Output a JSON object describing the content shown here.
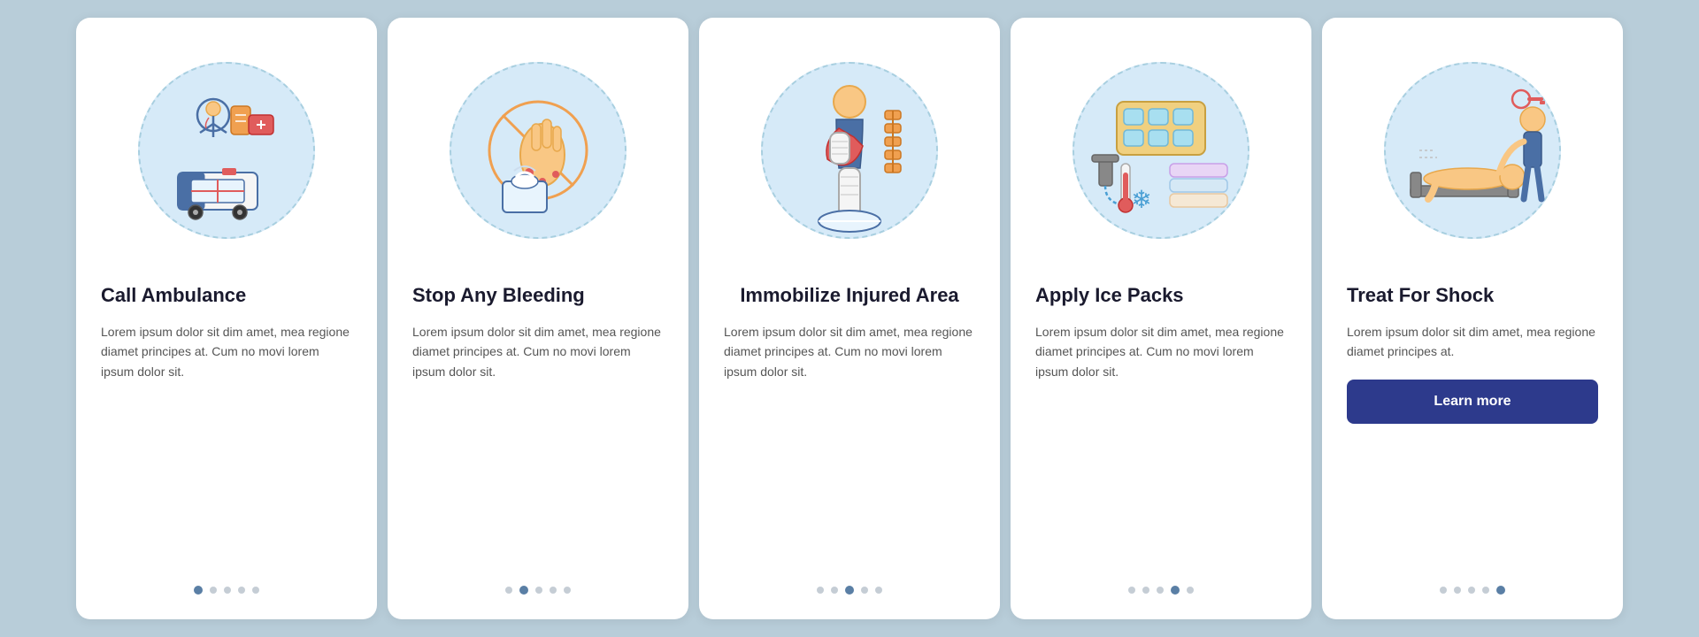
{
  "background_color": "#b8cdd9",
  "accent_color": "#2d3a8c",
  "cards": [
    {
      "id": "call-ambulance",
      "title": "Call Ambulance",
      "text": "Lorem ipsum dolor sit dim amet, mea regione diamet principes at. Cum no movi lorem ipsum dolor sit.",
      "active_dot": 1,
      "total_dots": 5
    },
    {
      "id": "stop-bleeding",
      "title": "Stop Any Bleeding",
      "text": "Lorem ipsum dolor sit dim amet, mea regione diamet principes at. Cum no movi lorem ipsum dolor sit.",
      "active_dot": 2,
      "total_dots": 5
    },
    {
      "id": "immobilize",
      "title": "Immobilize Injured Area",
      "text": "Lorem ipsum dolor sit dim amet, mea regione diamet principes at. Cum no movi lorem ipsum dolor sit.",
      "active_dot": 3,
      "total_dots": 5
    },
    {
      "id": "ice-packs",
      "title": "Apply Ice Packs",
      "text": "Lorem ipsum dolor sit dim amet, mea regione diamet principes at. Cum no movi lorem ipsum dolor sit.",
      "active_dot": 4,
      "total_dots": 5
    },
    {
      "id": "treat-shock",
      "title": "Treat For Shock",
      "text": "Lorem ipsum dolor sit dim amet, mea regione diamet principes at.",
      "active_dot": 5,
      "total_dots": 5,
      "has_button": true,
      "button_label": "Learn more"
    }
  ]
}
